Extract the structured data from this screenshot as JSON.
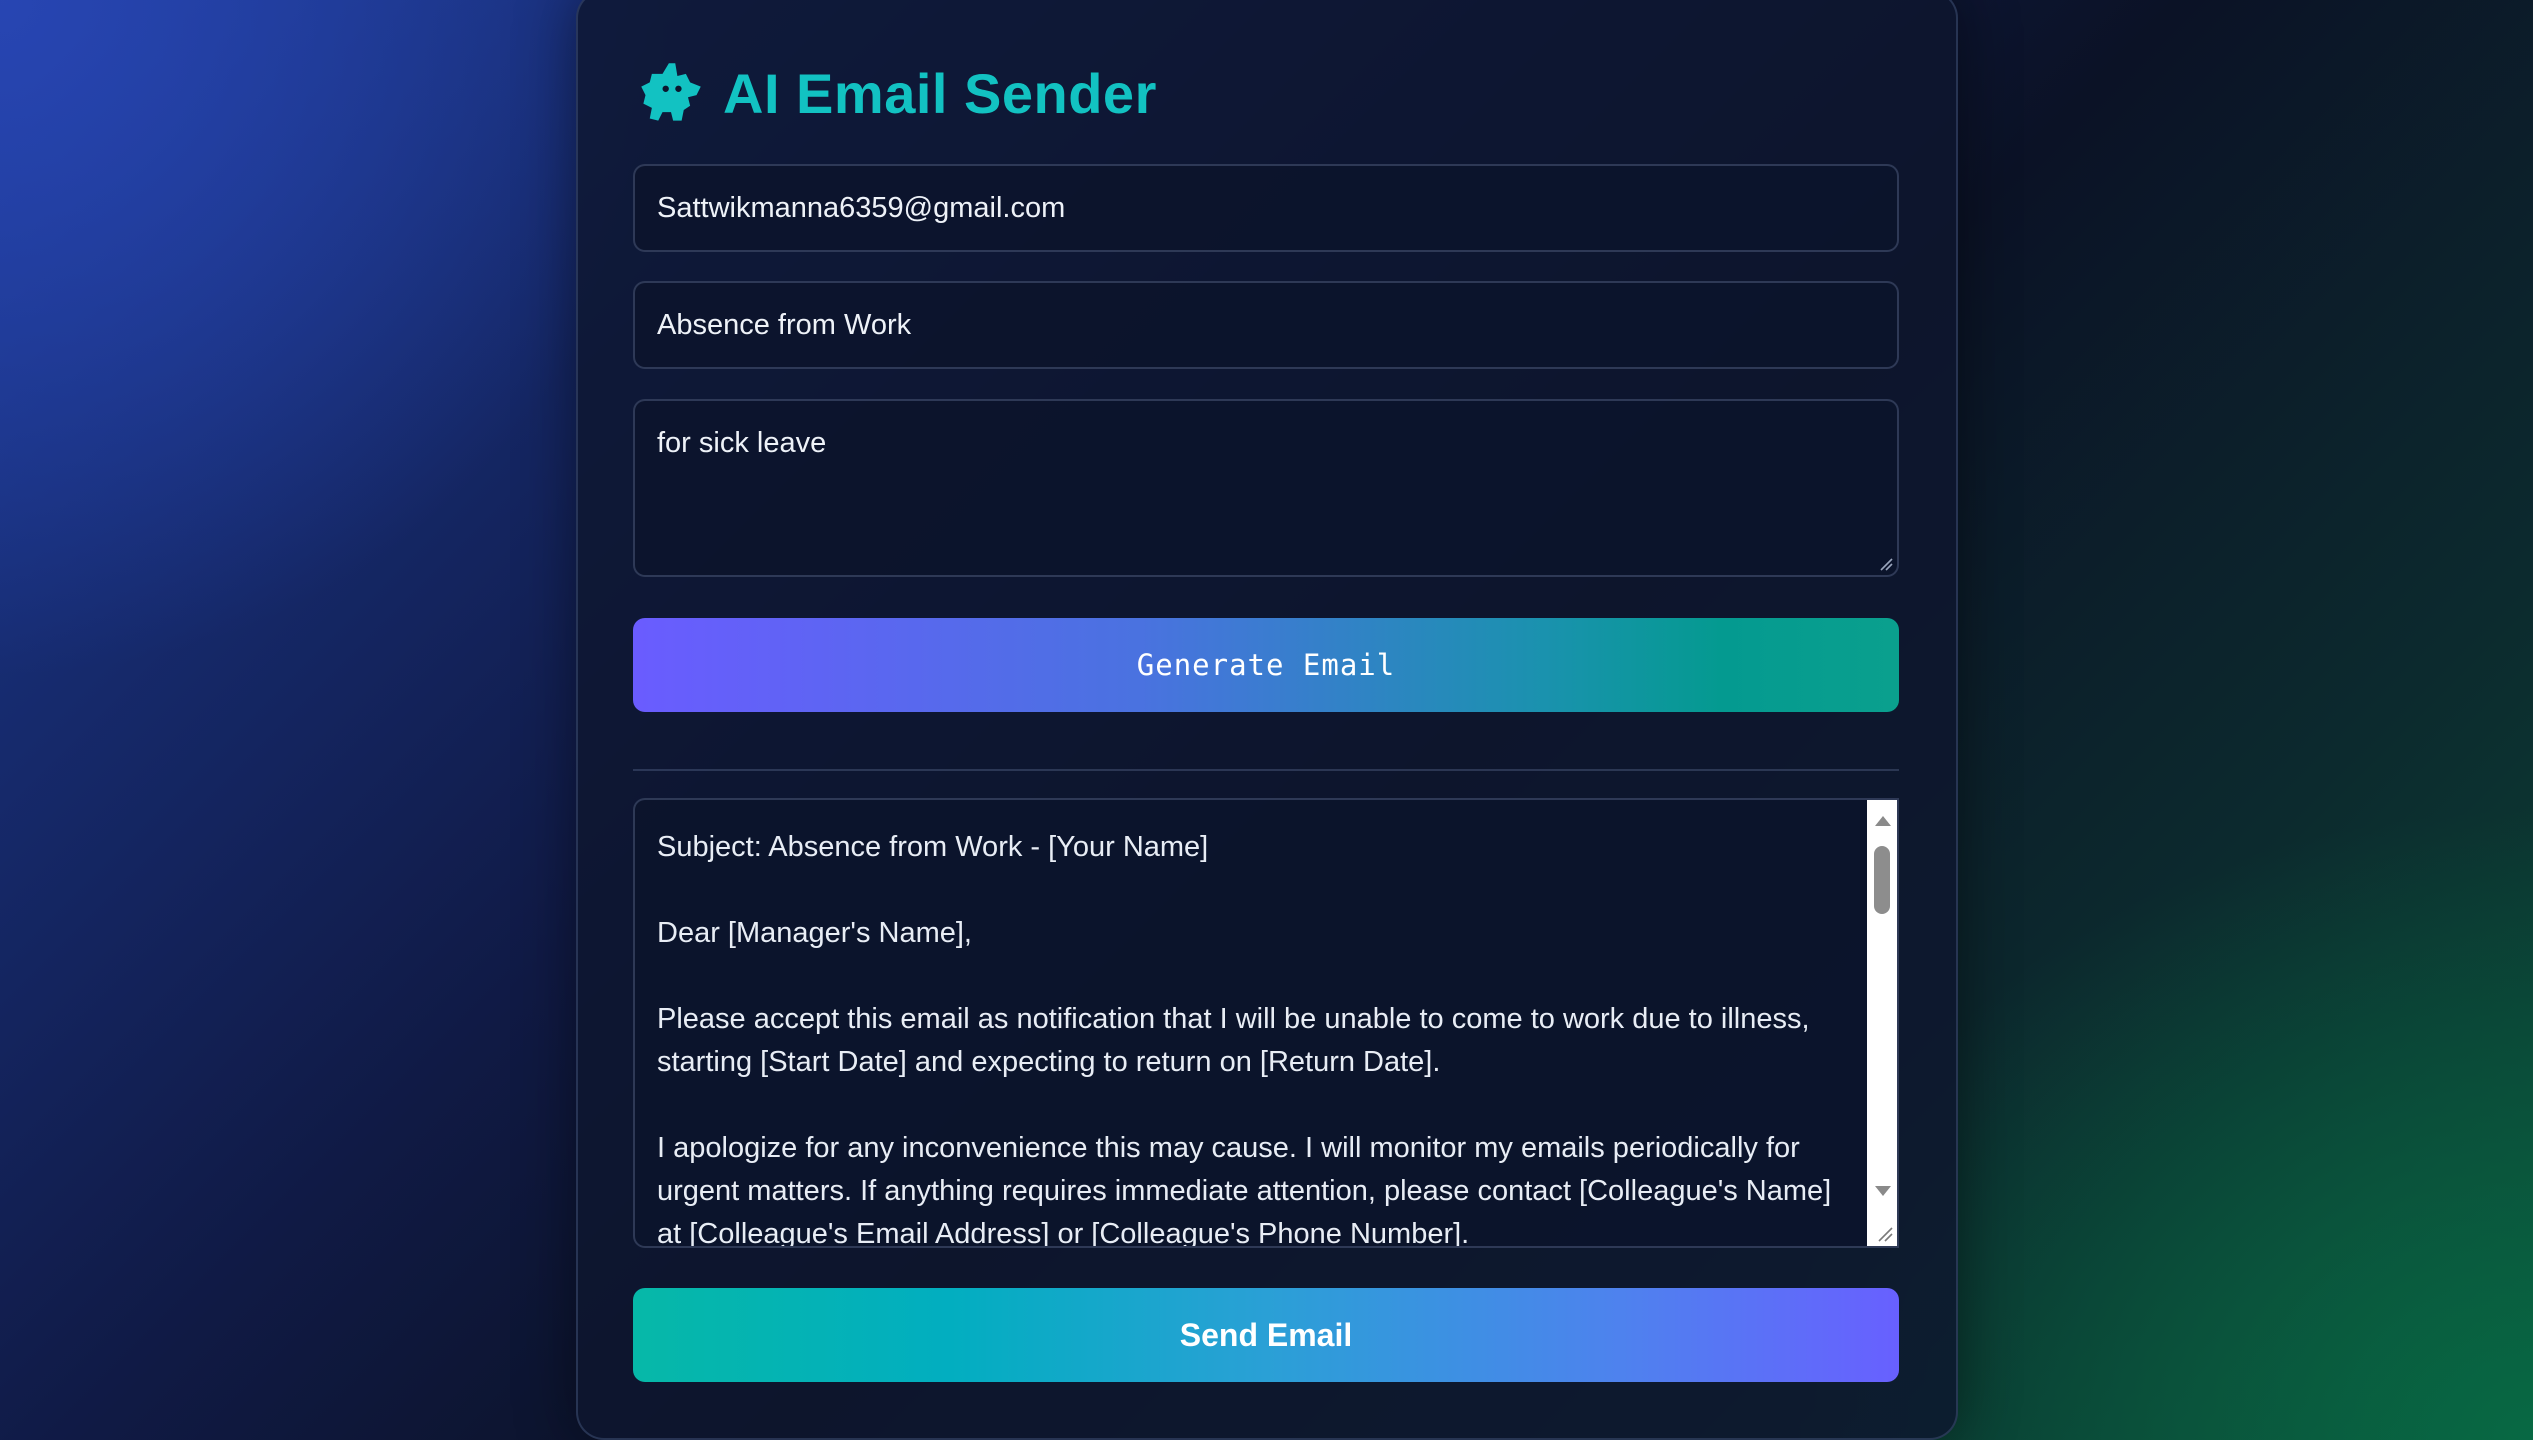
{
  "app": {
    "title": "AI Email Sender",
    "icon": "robot-icon",
    "accent_color": "#12c2c2"
  },
  "form": {
    "recipient_value": "Sattwikmanna6359@gmail.com",
    "subject_value": "Absence from Work",
    "prompt_value": "for sick leave",
    "generate_label": "Generate Email"
  },
  "output": {
    "paragraphs": [
      "Subject: Absence from Work - [Your Name]",
      "Dear [Manager's Name],",
      "Please accept this email as notification that I will be unable to come to work due to illness, starting [Start Date] and expecting to return on [Return Date].",
      "I apologize for any inconvenience this may cause. I will monitor my emails periodically for urgent matters.  If anything requires immediate attention, please contact [Colleague's Name] at [Colleague's Email Address] or [Colleague's Phone Number]."
    ]
  },
  "actions": {
    "send_label": "Send Email"
  }
}
